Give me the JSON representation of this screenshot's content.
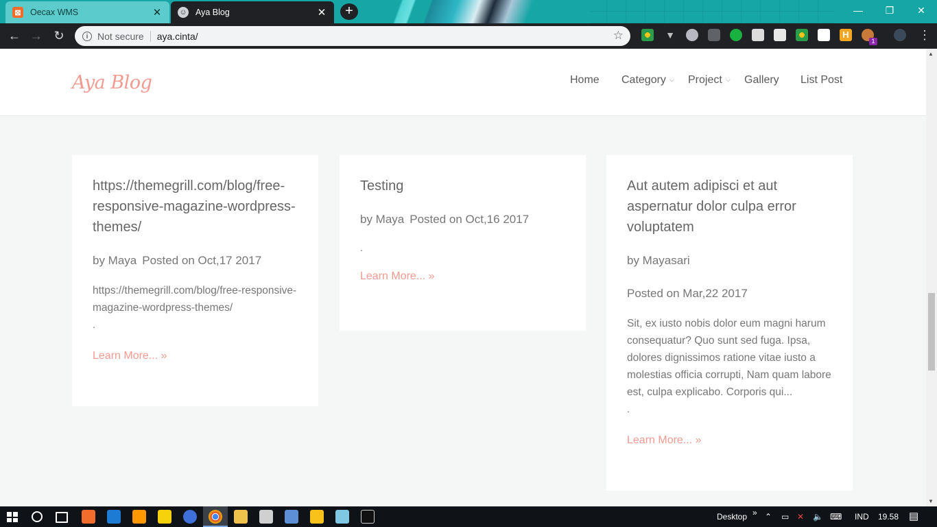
{
  "browser": {
    "tabs": [
      {
        "title": "Oecax WMS",
        "icon": "xampp-icon",
        "active": false
      },
      {
        "title": "Aya Blog",
        "icon": "anime-avatar-icon",
        "active": true
      }
    ],
    "new_tab_label": "+",
    "close_glyph": "✕",
    "window_controls": {
      "minimize": "—",
      "restore": "❐",
      "close": "✕"
    },
    "security_label": "Not secure",
    "url": "aya.cinta/",
    "extension_badge": "1",
    "colors": {
      "tabbar": "#16a6a6",
      "toolbar": "#202124",
      "inactive_tab": "#5ccbcb"
    }
  },
  "site": {
    "logo": "Aya Blog",
    "nav": [
      {
        "label": "Home",
        "dropdown": false
      },
      {
        "label": "Category",
        "dropdown": true
      },
      {
        "label": "Project",
        "dropdown": true
      },
      {
        "label": "Gallery",
        "dropdown": false
      },
      {
        "label": "List Post",
        "dropdown": false
      }
    ],
    "accent_color": "#f39a91",
    "posts": [
      {
        "title": "https://themegrill.com/blog/free-responsive-magazine-wordpress-themes/",
        "author": "by Maya",
        "date": "Posted on Oct,17 2017",
        "excerpt": "https://themegrill.com/blog/free-responsive-magazine-wordpress-themes/",
        "ellipsis": ".",
        "link": "Learn More... »"
      },
      {
        "title": "Testing",
        "author": "by Maya",
        "date": "Posted on Oct,16 2017",
        "excerpt": "",
        "ellipsis": ".",
        "link": "Learn More... »"
      },
      {
        "title": "Aut autem adipisci et aut aspernatur dolor culpa error voluptatem",
        "author": "by Mayasari",
        "date": "Posted on Mar,22 2017",
        "excerpt": "Sit, ex iusto nobis dolor eum magni harum consequatur? Quo sunt sed fuga. Ipsa, dolores dignissimos ratione vitae iusto a molestias officia corrupti, Nam quam labore est, culpa explicabo. Corporis qui...",
        "ellipsis": ".",
        "link": "Learn More... »"
      }
    ]
  },
  "taskbar": {
    "desktop_label": "Desktop",
    "chevron": "»",
    "language": "IND",
    "clock": "19.58"
  }
}
